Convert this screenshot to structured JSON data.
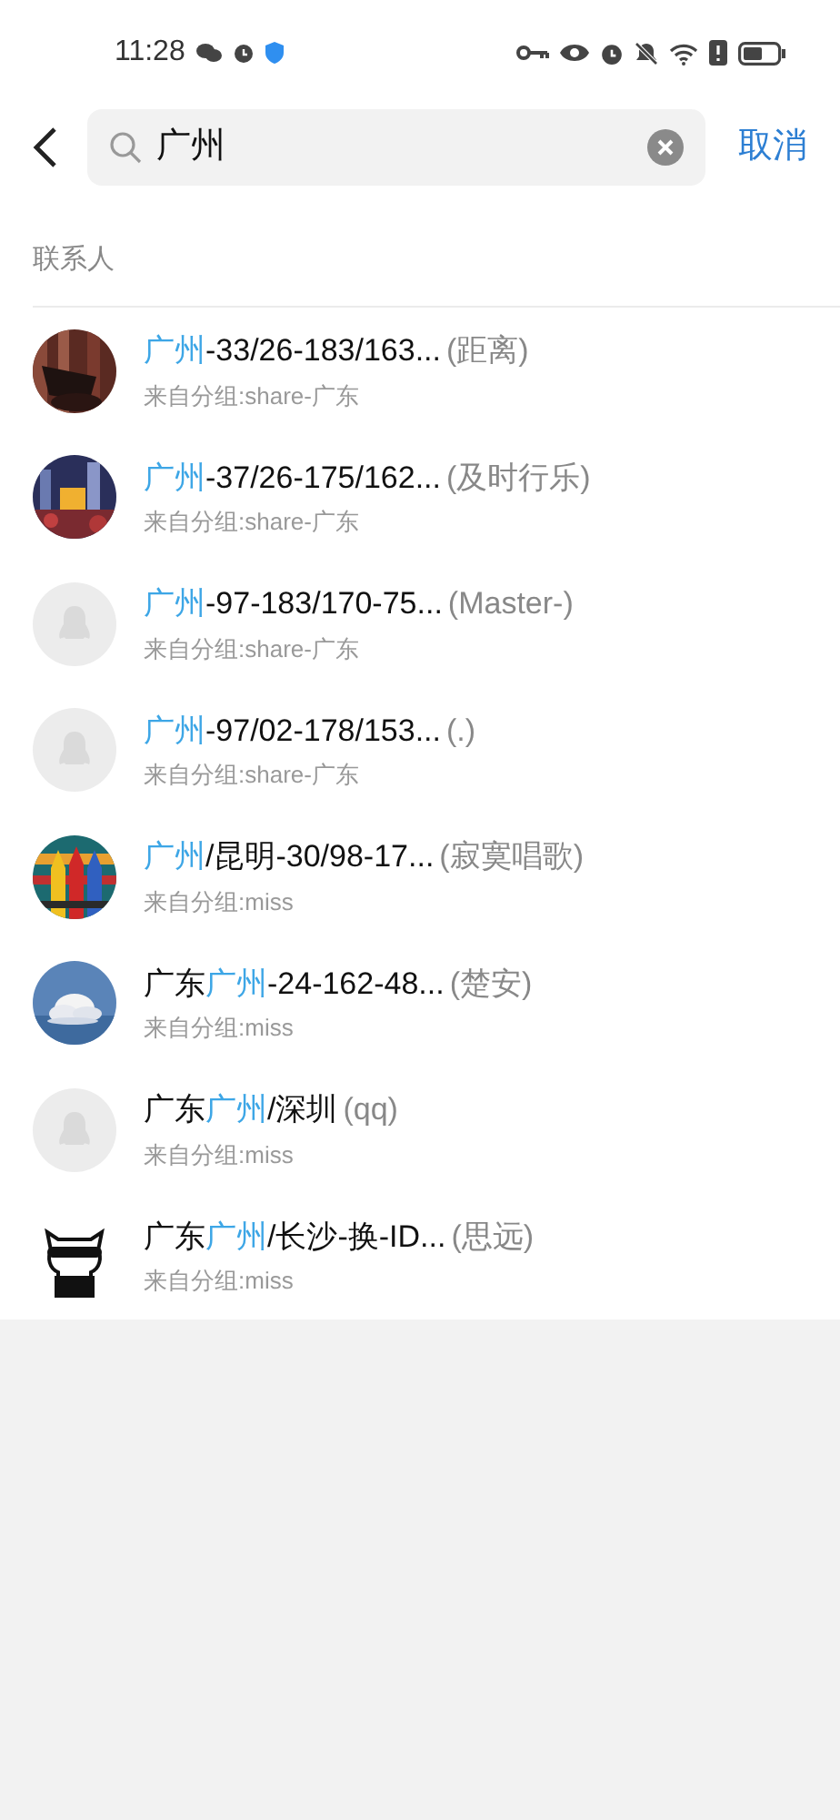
{
  "status_bar": {
    "time": "11:28"
  },
  "search": {
    "value": "广州",
    "cancel": "取消"
  },
  "section": {
    "title": "联系人"
  },
  "contacts": [
    {
      "name_parts": [
        {
          "text": "广州",
          "highlight": true
        },
        {
          "text": "-33/26-183/163...",
          "highlight": false
        }
      ],
      "nickname": "(距离)",
      "group": "来自分组:share-广东"
    },
    {
      "name_parts": [
        {
          "text": "广州",
          "highlight": true
        },
        {
          "text": "-37/26-175/162...",
          "highlight": false
        }
      ],
      "nickname": "(及时行乐)",
      "group": "来自分组:share-广东"
    },
    {
      "kind": "default",
      "name_parts": [
        {
          "text": "广州",
          "highlight": true
        },
        {
          "text": "-97-183/170-75...",
          "highlight": false
        }
      ],
      "nickname": "(Master-)",
      "group": "来自分组:share-广东"
    },
    {
      "kind": "default",
      "name_parts": [
        {
          "text": "广州",
          "highlight": true
        },
        {
          "text": "-97/02-178/153...",
          "highlight": false
        }
      ],
      "nickname": "(.)",
      "group": "来自分组:share-广东"
    },
    {
      "name_parts": [
        {
          "text": "广州",
          "highlight": true
        },
        {
          "text": "/昆明-30/98-17...",
          "highlight": false
        }
      ],
      "nickname": "(寂寞唱歌)",
      "group": "来自分组:miss"
    },
    {
      "name_parts": [
        {
          "text": "广东",
          "highlight": false
        },
        {
          "text": "广州",
          "highlight": true
        },
        {
          "text": "-24-162-48...",
          "highlight": false
        }
      ],
      "nickname": "(楚安)",
      "group": "来自分组:miss"
    },
    {
      "kind": "default",
      "name_parts": [
        {
          "text": "广东",
          "highlight": false
        },
        {
          "text": "广州",
          "highlight": true
        },
        {
          "text": "/深圳",
          "highlight": false
        }
      ],
      "nickname": "(qq)",
      "group": "来自分组:miss"
    },
    {
      "kind": "cartoon",
      "name_parts": [
        {
          "text": "广东",
          "highlight": false
        },
        {
          "text": "广州",
          "highlight": true
        },
        {
          "text": "/长沙-换-ID...",
          "highlight": false
        }
      ],
      "nickname": "(思远)",
      "group": "来自分组:miss"
    }
  ]
}
